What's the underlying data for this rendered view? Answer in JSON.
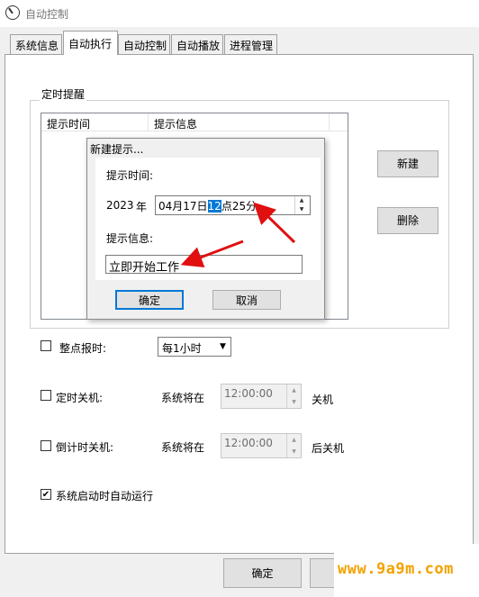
{
  "window": {
    "title": "自动控制"
  },
  "tabs": [
    {
      "label": "系统信息",
      "active": false
    },
    {
      "label": "自动执行",
      "active": true
    },
    {
      "label": "自动控制",
      "active": false
    },
    {
      "label": "自动播放",
      "active": false
    },
    {
      "label": "进程管理",
      "active": false
    }
  ],
  "reminder_group": {
    "label": "定时提醒",
    "columns": [
      "提示时间",
      "提示信息"
    ],
    "new_button": "新建",
    "delete_button": "删除"
  },
  "dialog": {
    "title": "新建提示...",
    "time_label": "提示时间:",
    "year": "2023",
    "year_unit": "年",
    "datetime_before": "04月17日",
    "datetime_selected": "12",
    "datetime_after": "点25分",
    "message_label": "提示信息:",
    "message_value": "立即开始工作",
    "ok_button": "确定",
    "cancel_button": "取消"
  },
  "options": {
    "hourly_label": "整点报时:",
    "hourly_checked": false,
    "hourly_select": "每1小时",
    "shutdown_label": "定时关机:",
    "shutdown_checked": false,
    "shutdown_prefix": "系统将在",
    "shutdown_time": "12:00:00",
    "shutdown_suffix": "关机",
    "countdown_label": "倒计时关机:",
    "countdown_checked": false,
    "countdown_prefix": "系统将在",
    "countdown_time": "12:00:00",
    "countdown_suffix": "后关机",
    "autorun_label": "系统启动时自动运行",
    "autorun_checked": true,
    "check_mark": "✔"
  },
  "footer": {
    "ok_button": "确定"
  },
  "watermark": "www.9a9m.com",
  "colors": {
    "accent": "#0078d7",
    "arrow": "#e01010",
    "watermark": "#f2a200"
  }
}
